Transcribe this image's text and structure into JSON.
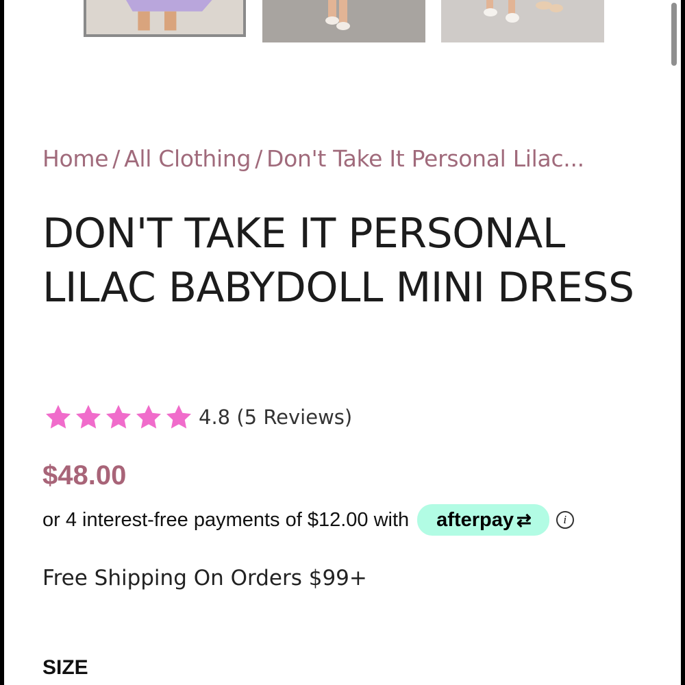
{
  "gallery": {
    "thumbnails": [
      {
        "name": "product-thumbnail-1",
        "selected": true
      },
      {
        "name": "product-thumbnail-2",
        "selected": false
      },
      {
        "name": "product-thumbnail-3",
        "selected": false
      }
    ]
  },
  "breadcrumb": {
    "items": [
      "Home",
      "All Clothing",
      "Don't Take It Personal Lilac..."
    ],
    "separator": "/"
  },
  "product": {
    "title": "DON'T TAKE IT PERSONAL LILAC BABYDOLL MINI DRESS",
    "rating": {
      "stars": 5,
      "text": "4.8 (5 Reviews)",
      "star_color": "#f06ccb"
    },
    "price": "$48.00",
    "price_color": "#a86478"
  },
  "afterpay": {
    "text": "or 4 interest-free payments of $12.00 with",
    "badge_label": "afterpay",
    "badge_color": "#b2fce4",
    "info_icon": "info-icon",
    "info_glyph": "i"
  },
  "shipping": {
    "text": "Free Shipping On Orders $99+"
  },
  "size": {
    "label": "SIZE"
  }
}
